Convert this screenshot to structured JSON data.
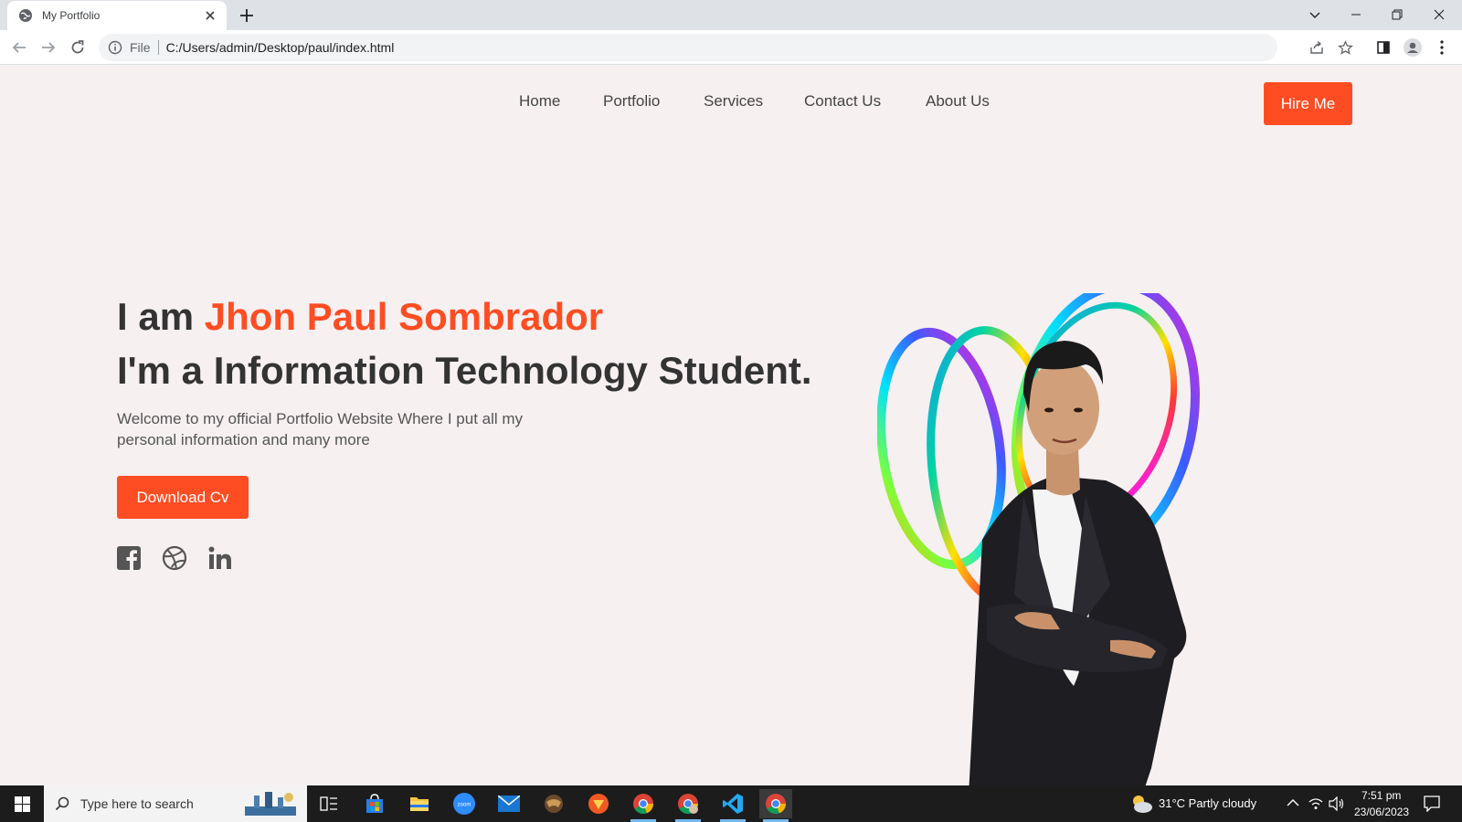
{
  "browser": {
    "tab_title": "My Portfolio",
    "url_scheme_label": "File",
    "url": "C:/Users/admin/Desktop/paul/index.html"
  },
  "site": {
    "nav": [
      "Home",
      "Portfolio",
      "Services",
      "Contact Us",
      "About Us"
    ],
    "hire_label": "Hire Me",
    "intro_prefix": "I am",
    "name": "Jhon Paul Sombrador",
    "role": "I'm a Information Technology Student.",
    "description": "Welcome to my official Portfolio Website Where I put all my personal information and many more",
    "cv_label": "Download Cv",
    "accent_color": "#ff4d23",
    "social_icons": [
      "facebook-icon",
      "dribbble-icon",
      "linkedin-icon"
    ]
  },
  "taskbar": {
    "search_placeholder": "Type here to search",
    "weather": "31°C  Partly cloudy",
    "time": "7:51 pm",
    "date": "23/06/2023"
  }
}
